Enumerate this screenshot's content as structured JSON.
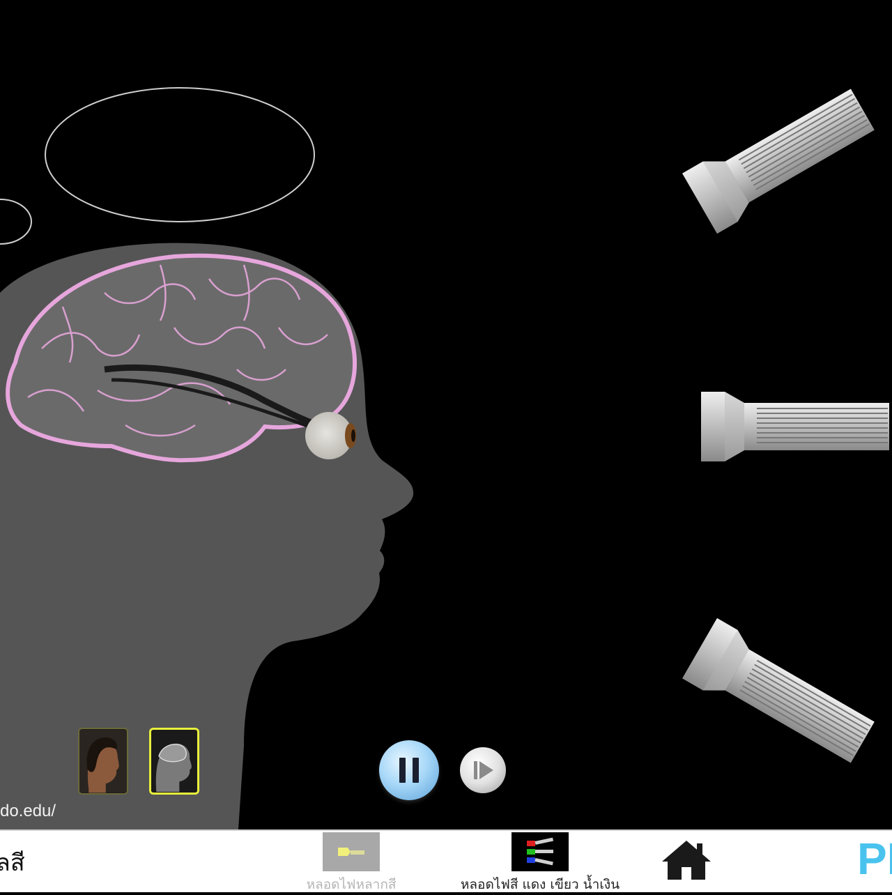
{
  "scene": {
    "url_fragment": "do.edu/"
  },
  "view_toggle": {
    "options": [
      "face-view",
      "brain-view"
    ],
    "selected": "brain-view"
  },
  "playback": {
    "state": "playing"
  },
  "bottom_bar": {
    "left_label": "ลสี",
    "menu": [
      {
        "label": "หลอดไฟหลากสี",
        "enabled": false
      },
      {
        "label": "หลอดไฟสี แดง เขียว น้ำเงิน",
        "enabled": true
      }
    ],
    "logo_text": "PI"
  },
  "colors": {
    "background": "#000000",
    "head": "#555555",
    "brain_outline": "#e6a6dc",
    "pause_button": "#a8d8f8",
    "logo": "#49c3ee"
  },
  "icons": [
    "flashlight-icon",
    "eye-icon",
    "pause-icon",
    "step-forward-icon",
    "home-icon"
  ]
}
